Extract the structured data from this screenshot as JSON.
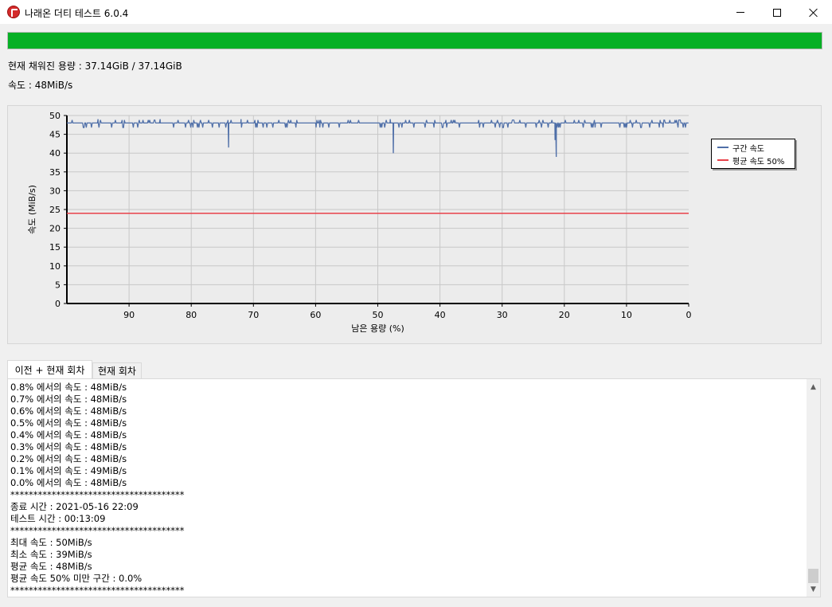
{
  "window": {
    "title": "나래온 더티 테스트 6.0.4",
    "icons": {
      "app": "app-logo-icon",
      "minimize": "minimize-icon",
      "maximize": "maximize-icon",
      "close": "close-icon"
    }
  },
  "progress": {
    "fraction": 1.0,
    "color": "#06b025"
  },
  "status": {
    "filled_capacity": "현재 채워진 용량 : 37.14GiB / 37.14GiB",
    "speed": "속도 : 48MiB/s"
  },
  "chart_data": {
    "type": "line",
    "xlabel": "남은 용량 (%)",
    "ylabel": "속도 (MiB/s)",
    "xlim": [
      100,
      0
    ],
    "ylim": [
      0,
      50
    ],
    "x_ticks": [
      "90",
      "80",
      "70",
      "60",
      "50",
      "40",
      "30",
      "20",
      "10",
      "0"
    ],
    "y_ticks": [
      "0",
      "5",
      "10",
      "15",
      "20",
      "25",
      "30",
      "35",
      "40",
      "45",
      "50"
    ],
    "grid": true,
    "legend_position": "right",
    "series": [
      {
        "name": "구간 속도",
        "color": "#4f6fa8",
        "baseline": 48,
        "x": [
          99.5,
          97.0,
          95.0,
          85.0,
          74.0,
          72.0,
          65.0,
          60.0,
          55.0,
          48.0,
          47.5,
          47.0,
          40.0,
          35.0,
          30.0,
          25.0,
          21.5,
          21.3,
          21.0,
          15.0,
          10.0,
          5.0,
          0.0
        ],
        "y": [
          48,
          48,
          49,
          49,
          41.5,
          49,
          48,
          48,
          48,
          49,
          40,
          48,
          48,
          48,
          48,
          48,
          43.5,
          39,
          48,
          48,
          48,
          48,
          48
        ]
      },
      {
        "name": "평균 속도 50%",
        "color": "#e8424a",
        "x": [
          100,
          0
        ],
        "y": [
          24,
          24
        ]
      }
    ]
  },
  "tabs": [
    {
      "label": "이전 + 현재 회차",
      "active": true
    },
    {
      "label": "현재 회차",
      "active": false
    }
  ],
  "log": {
    "lines": [
      "0.8% 에서의 속도 : 48MiB/s",
      "0.7% 에서의 속도 : 48MiB/s",
      "0.6% 에서의 속도 : 48MiB/s",
      "0.5% 에서의 속도 : 48MiB/s",
      "0.4% 에서의 속도 : 48MiB/s",
      "0.3% 에서의 속도 : 48MiB/s",
      "0.2% 에서의 속도 : 48MiB/s",
      "0.1% 에서의 속도 : 49MiB/s",
      "0.0% 에서의 속도 : 48MiB/s",
      "**************************************",
      "종료 시간 : 2021-05-16 22:09",
      "테스트 시간 : 00:13:09",
      "**************************************",
      "최대 속도 : 50MiB/s",
      "최소 속도 : 39MiB/s",
      "평균 속도 : 48MiB/s",
      "평균 속도 50% 미만 구간 : 0.0%",
      "**************************************"
    ],
    "scroll_icons": {
      "up": "scroll-up-arrow-icon",
      "down": "scroll-down-arrow-icon"
    }
  }
}
